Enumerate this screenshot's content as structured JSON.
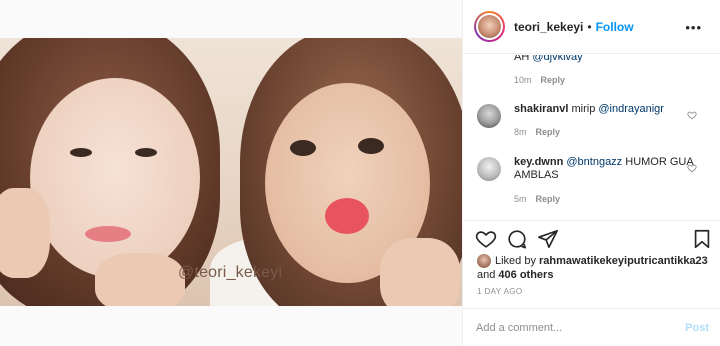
{
  "header": {
    "username": "teori_kekeyi",
    "separator": "•",
    "follow_label": "Follow",
    "more_label": "•••",
    "avatar_icon": "avatar-icon"
  },
  "photo": {
    "watermark": "@teori_kekeyi"
  },
  "comments": [
    {
      "user": "",
      "text_pre": "AH ",
      "mention": "@djvkivay",
      "text_post": "",
      "time": "10m",
      "reply_label": "Reply"
    },
    {
      "user": "shakiranvl",
      "text_pre": " mirip ",
      "mention": "@indrayanigr",
      "text_post": "",
      "time": "8m",
      "reply_label": "Reply"
    },
    {
      "user": "key.dwnn",
      "text_pre": " ",
      "mention": "@bntngazz",
      "text_post": " HUMOR GUA AMBLAS",
      "time": "5m",
      "reply_label": "Reply"
    }
  ],
  "actions": {
    "like_icon": "heart-icon",
    "comment_icon": "comment-icon",
    "share_icon": "send-icon",
    "save_icon": "bookmark-icon"
  },
  "likes": {
    "prefix": "Liked by ",
    "user": "rahmawatikekeyiputricantikka23",
    "middle": " and ",
    "others": "406 others"
  },
  "timestamp": "1 DAY AGO",
  "add_comment": {
    "placeholder": "Add a comment...",
    "post_label": "Post"
  },
  "colors": {
    "link_blue": "#0095f6",
    "mention": "#00376b",
    "muted": "#8e8e8e",
    "post_disabled": "#b2dffc"
  }
}
